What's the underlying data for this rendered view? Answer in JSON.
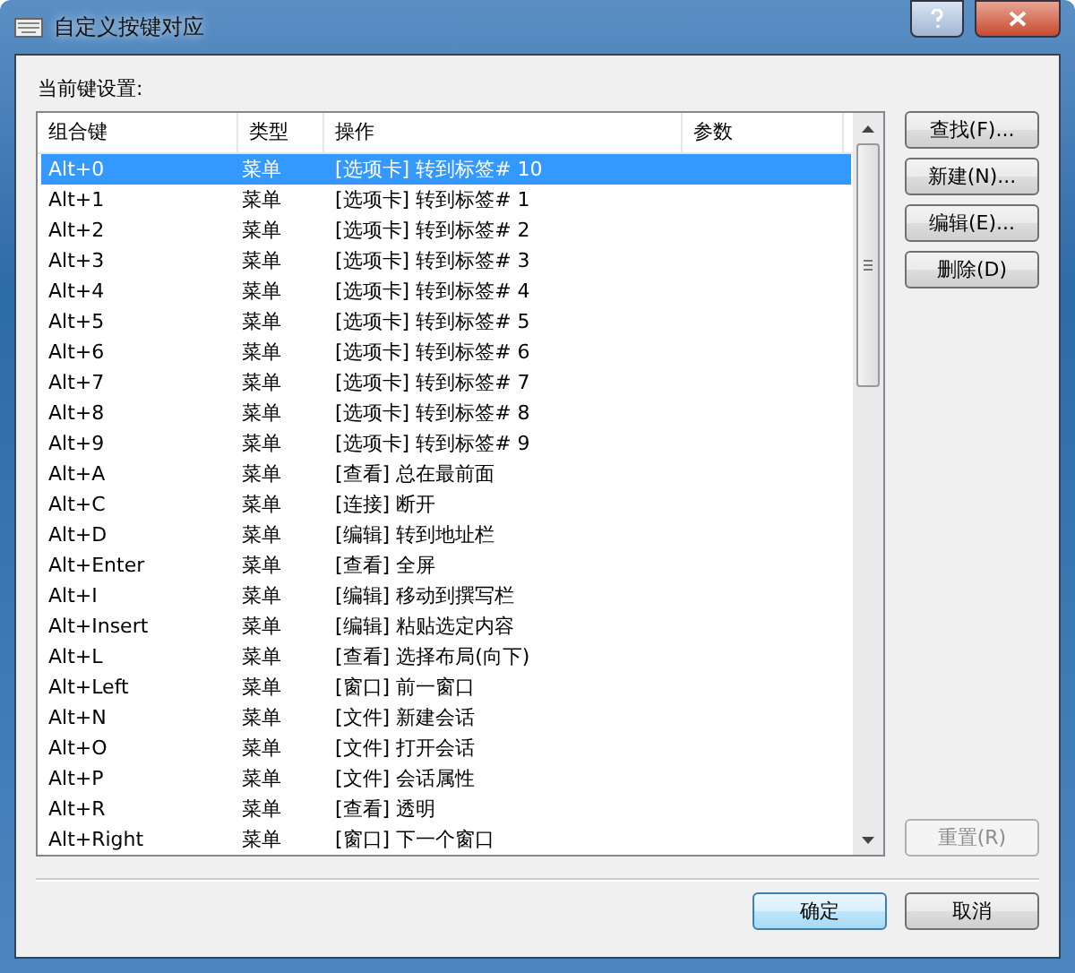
{
  "window": {
    "title": "自定义按键对应"
  },
  "list_label": "当前键设置:",
  "table": {
    "columns": [
      "组合键",
      "类型",
      "操作",
      "参数"
    ],
    "rows": [
      {
        "cells": [
          "Alt+0",
          "菜单",
          "[选项卡] 转到标签# 10"
        ],
        "selected": true
      },
      {
        "cells": [
          "Alt+1",
          "菜单",
          "[选项卡] 转到标签# 1"
        ],
        "selected": false
      },
      {
        "cells": [
          "Alt+2",
          "菜单",
          "[选项卡] 转到标签# 2"
        ],
        "selected": false
      },
      {
        "cells": [
          "Alt+3",
          "菜单",
          "[选项卡] 转到标签# 3"
        ],
        "selected": false
      },
      {
        "cells": [
          "Alt+4",
          "菜单",
          "[选项卡] 转到标签# 4"
        ],
        "selected": false
      },
      {
        "cells": [
          "Alt+5",
          "菜单",
          "[选项卡] 转到标签# 5"
        ],
        "selected": false
      },
      {
        "cells": [
          "Alt+6",
          "菜单",
          "[选项卡] 转到标签# 6"
        ],
        "selected": false
      },
      {
        "cells": [
          "Alt+7",
          "菜单",
          "[选项卡] 转到标签# 7"
        ],
        "selected": false
      },
      {
        "cells": [
          "Alt+8",
          "菜单",
          "[选项卡] 转到标签# 8"
        ],
        "selected": false
      },
      {
        "cells": [
          "Alt+9",
          "菜单",
          "[选项卡] 转到标签# 9"
        ],
        "selected": false
      },
      {
        "cells": [
          "Alt+A",
          "菜单",
          "[查看] 总在最前面"
        ],
        "selected": false
      },
      {
        "cells": [
          "Alt+C",
          "菜单",
          "[连接] 断开"
        ],
        "selected": false
      },
      {
        "cells": [
          "Alt+D",
          "菜单",
          "[编辑] 转到地址栏"
        ],
        "selected": false
      },
      {
        "cells": [
          "Alt+Enter",
          "菜单",
          "[查看] 全屏"
        ],
        "selected": false
      },
      {
        "cells": [
          "Alt+I",
          "菜单",
          "[编辑] 移动到撰写栏"
        ],
        "selected": false
      },
      {
        "cells": [
          "Alt+Insert",
          "菜单",
          "[编辑] 粘贴选定内容"
        ],
        "selected": false
      },
      {
        "cells": [
          "Alt+L",
          "菜单",
          "[查看] 选择布局(向下)"
        ],
        "selected": false
      },
      {
        "cells": [
          "Alt+Left",
          "菜单",
          "[窗口] 前一窗口"
        ],
        "selected": false
      },
      {
        "cells": [
          "Alt+N",
          "菜单",
          "[文件] 新建会话"
        ],
        "selected": false
      },
      {
        "cells": [
          "Alt+O",
          "菜单",
          "[文件] 打开会话"
        ],
        "selected": false
      },
      {
        "cells": [
          "Alt+P",
          "菜单",
          "[文件] 会话属性"
        ],
        "selected": false
      },
      {
        "cells": [
          "Alt+R",
          "菜单",
          "[查看] 透明"
        ],
        "selected": false
      },
      {
        "cells": [
          "Alt+Right",
          "菜单",
          "[窗口] 下一个窗口"
        ],
        "selected": false
      }
    ]
  },
  "side_buttons": [
    {
      "label": "查找(F)...",
      "disabled": false
    },
    {
      "label": "新建(N)...",
      "disabled": false
    },
    {
      "label": "编辑(E)...",
      "disabled": false
    },
    {
      "label": "删除(D)",
      "disabled": false
    }
  ],
  "reset_button": {
    "label": "重置(R)",
    "disabled": true
  },
  "dialog_buttons": [
    {
      "label": "确定",
      "selected": true
    },
    {
      "label": "取消",
      "selected": false
    }
  ]
}
